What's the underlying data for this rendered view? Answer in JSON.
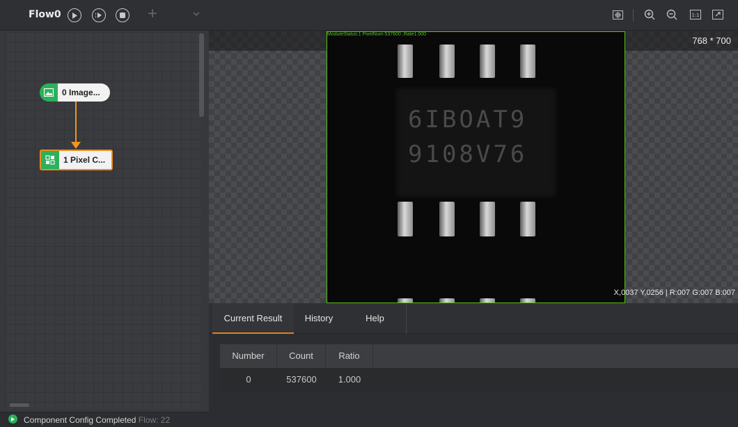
{
  "flow_toolbar": {
    "title": "Flow0"
  },
  "nodes": [
    {
      "label": "0 Image..."
    },
    {
      "label": "1 Pixel C..."
    }
  ],
  "status_bar": {
    "message": "Component Config Completed",
    "suffix": "Flow: 22"
  },
  "viewer": {
    "module_status": "ModuleStatus:1 PixelNum:537600 ,Rate1.000",
    "image_size": "768 * 700",
    "pixel_info": "X,0037  Y,0256  |  R:007  G:007  B:007",
    "chip_mark": [
      "6IBOAT9",
      "9108V76"
    ]
  },
  "result_tabs": [
    "Current Result",
    "History",
    "Help"
  ],
  "table": {
    "headers": [
      "Number",
      "Count",
      "Ratio"
    ],
    "rows": [
      [
        "0",
        "537600",
        "1.000"
      ]
    ]
  },
  "colors": {
    "accent": "#e67e22",
    "success": "#2bb15b",
    "roi": "#52c41a"
  }
}
